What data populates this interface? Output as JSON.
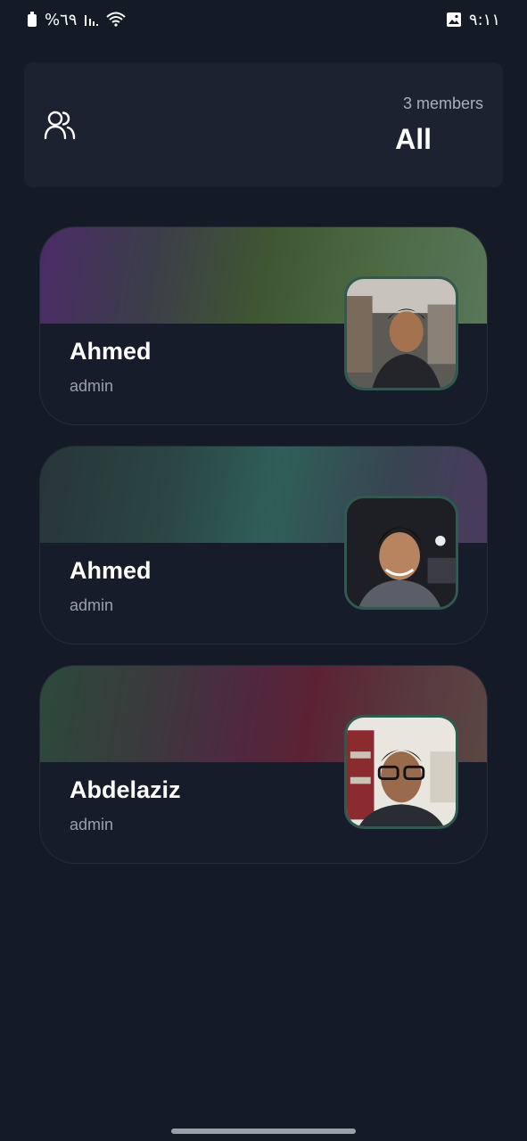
{
  "status_bar": {
    "battery_text": "%٦٩",
    "time": "٩:١١",
    "icons": [
      "battery-icon",
      "signal-icon",
      "wifi-icon",
      "gallery-notification-icon"
    ]
  },
  "header": {
    "icon": "group-icon",
    "members_count": "3 members",
    "title": "All"
  },
  "members": [
    {
      "name": "Ahmed",
      "role": "admin",
      "banner_colors": [
        "#4a2a66",
        "#3f5a34",
        "#56734f"
      ]
    },
    {
      "name": "Ahmed",
      "role": "admin",
      "banner_colors": [
        "#2a3a3c",
        "#2f5e58",
        "#4a3a5c"
      ]
    },
    {
      "name": "Abdelaziz",
      "role": "admin",
      "banner_colors": [
        "#2e4a3c",
        "#5c2236",
        "#5c4646"
      ]
    }
  ],
  "colors": {
    "background": "#141a26",
    "card": "#1c2230",
    "avatar_border": "#2f5a4d",
    "muted_text": "#98a0ae"
  }
}
